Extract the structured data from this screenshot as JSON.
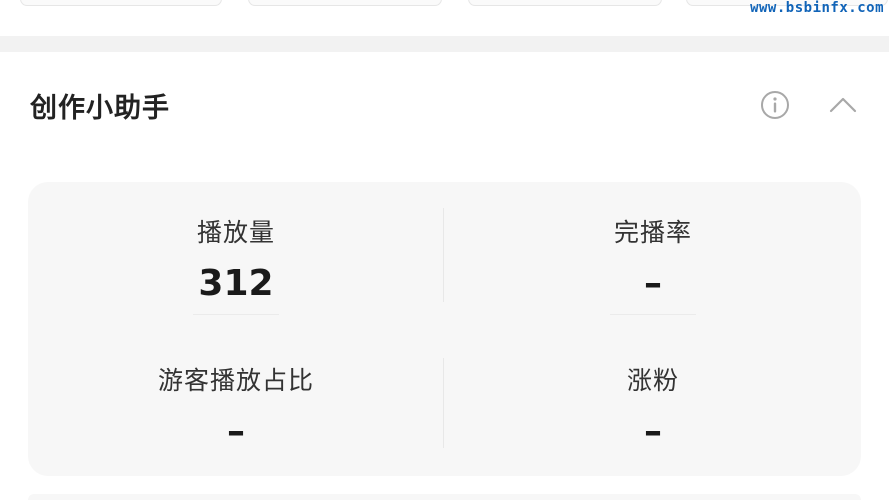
{
  "watermark": "www.bsbinfx.com",
  "assistant": {
    "title": "创作小助手",
    "info_icon": "info-icon",
    "collapse_icon": "chevron-up-icon"
  },
  "stats": [
    {
      "label": "播放量",
      "value": "312"
    },
    {
      "label": "完播率",
      "value": "–"
    },
    {
      "label": "游客播放占比",
      "value": "–"
    },
    {
      "label": "涨粉",
      "value": "–"
    }
  ]
}
